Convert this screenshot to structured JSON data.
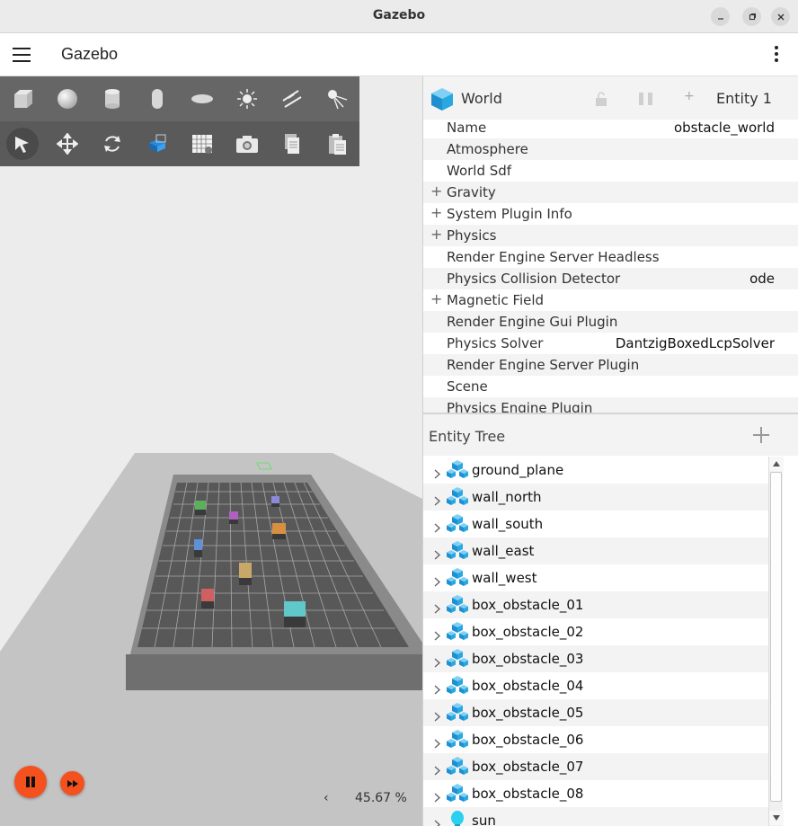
{
  "window": {
    "title": "Gazebo"
  },
  "app": {
    "title": "Gazebo"
  },
  "toolbar": {
    "shapes": [
      "box-icon",
      "sphere-icon",
      "cylinder-icon",
      "capsule-icon",
      "ellipsoid-icon",
      "point-light-icon",
      "directional-light-icon",
      "spot-light-icon"
    ],
    "transform": [
      "select-icon",
      "translate-icon",
      "rotate-icon",
      "view-angle-icon",
      "grid-snap-icon",
      "screenshot-icon",
      "copy-icon",
      "paste-icon"
    ]
  },
  "sim": {
    "rtf": "45.67 %",
    "collapse_arrow": "‹"
  },
  "component_inspector": {
    "title": "World",
    "entity_id": "Entity 1",
    "properties": [
      {
        "name": "Name",
        "value": "obstacle_world",
        "expandable": false
      },
      {
        "name": "Atmosphere",
        "value": "",
        "expandable": false
      },
      {
        "name": "World Sdf",
        "value": "",
        "expandable": false
      },
      {
        "name": "Gravity",
        "value": "",
        "expandable": true
      },
      {
        "name": "System Plugin Info",
        "value": "",
        "expandable": true
      },
      {
        "name": "Physics",
        "value": "",
        "expandable": true
      },
      {
        "name": "Render Engine Server Headless",
        "value": "",
        "expandable": false
      },
      {
        "name": "Physics Collision Detector",
        "value": "ode",
        "expandable": false
      },
      {
        "name": "Magnetic Field",
        "value": "",
        "expandable": true
      },
      {
        "name": "Render Engine Gui Plugin",
        "value": "",
        "expandable": false
      },
      {
        "name": "Physics Solver",
        "value": "DantzigBoxedLcpSolver",
        "expandable": false
      },
      {
        "name": "Render Engine Server Plugin",
        "value": "",
        "expandable": false
      },
      {
        "name": "Scene",
        "value": "",
        "expandable": false
      },
      {
        "name": "Physics Engine Plugin",
        "value": "",
        "expandable": false
      }
    ]
  },
  "entity_tree": {
    "title": "Entity Tree",
    "items": [
      {
        "label": "ground_plane",
        "icon": "model-icon"
      },
      {
        "label": "wall_north",
        "icon": "model-icon"
      },
      {
        "label": "wall_south",
        "icon": "model-icon"
      },
      {
        "label": "wall_east",
        "icon": "model-icon"
      },
      {
        "label": "wall_west",
        "icon": "model-icon"
      },
      {
        "label": "box_obstacle_01",
        "icon": "model-icon"
      },
      {
        "label": "box_obstacle_02",
        "icon": "model-icon"
      },
      {
        "label": "box_obstacle_03",
        "icon": "model-icon"
      },
      {
        "label": "box_obstacle_04",
        "icon": "model-icon"
      },
      {
        "label": "box_obstacle_05",
        "icon": "model-icon"
      },
      {
        "label": "box_obstacle_06",
        "icon": "model-icon"
      },
      {
        "label": "box_obstacle_07",
        "icon": "model-icon"
      },
      {
        "label": "box_obstacle_08",
        "icon": "model-icon"
      },
      {
        "label": "sun",
        "icon": "light-icon"
      }
    ]
  },
  "colors": {
    "accent": "#f4511e",
    "cube": "#29a8e0",
    "toolbar": "#5e5e5e"
  }
}
